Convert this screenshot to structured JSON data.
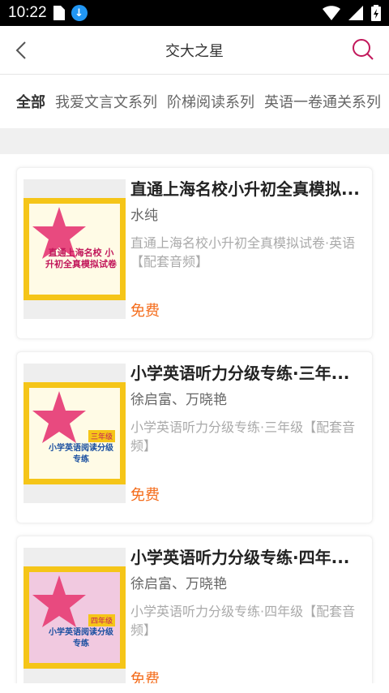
{
  "status": {
    "time": "10:22"
  },
  "appbar": {
    "title": "交大之星"
  },
  "tabs": [
    "全部",
    "我爱文言文系列",
    "阶梯阅读系列",
    "英语一卷通关系列"
  ],
  "books": [
    {
      "title": "直通上海名校小升初全真模拟...",
      "author": "水纯",
      "desc": "直通上海名校小升初全真模拟试卷·英语【配套音频】",
      "price": "免费",
      "cover_title": "直通上海名校 小升初全真模拟试卷",
      "cover_grade": ""
    },
    {
      "title": "小学英语听力分级专练·三年...",
      "author": "徐启富、万晓艳",
      "desc": "小学英语听力分级专练·三年级【配套音频】",
      "price": "免费",
      "cover_title": "小学英语阅读分级专练",
      "cover_grade": "三年级"
    },
    {
      "title": "小学英语听力分级专练·四年...",
      "author": "徐启富、万晓艳",
      "desc": "小学英语听力分级专练·四年级【配套音频】",
      "price": "免费",
      "cover_title": "小学英语阅读分级专练",
      "cover_grade": "四年级"
    }
  ],
  "colors": {
    "accent": "#f46c1b",
    "search_icon": "#c2185b",
    "cover_yellow": "#f5c518"
  }
}
